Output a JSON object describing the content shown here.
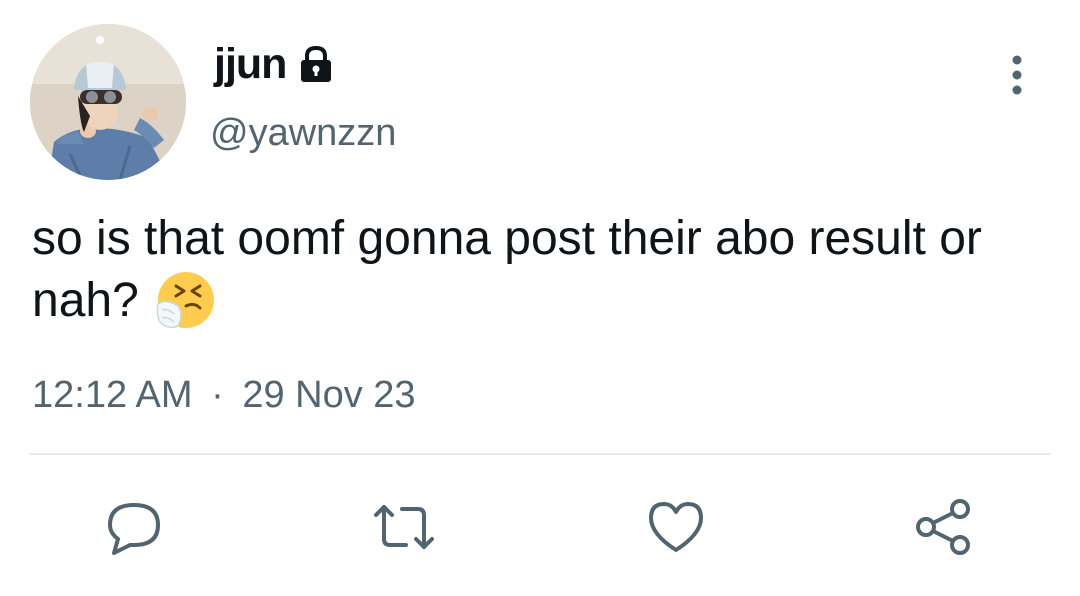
{
  "user": {
    "display_name": "jjun",
    "handle": "@yawnzzn",
    "protected": true
  },
  "tweet": {
    "text": "so is that oomf gonna post their abo result or nah?",
    "emoji": "sneezing-face-emoji",
    "time": "12:12 AM",
    "separator": "·",
    "date": "29 Nov 23"
  },
  "actions": [
    {
      "name": "reply",
      "icon": "reply-icon"
    },
    {
      "name": "retweet",
      "icon": "retweet-icon"
    },
    {
      "name": "like",
      "icon": "heart-icon"
    },
    {
      "name": "share",
      "icon": "share-icon"
    }
  ],
  "colors": {
    "text_primary": "#0f1419",
    "text_secondary": "#536471",
    "divider": "#e6e9eb",
    "icon": "#536471"
  }
}
